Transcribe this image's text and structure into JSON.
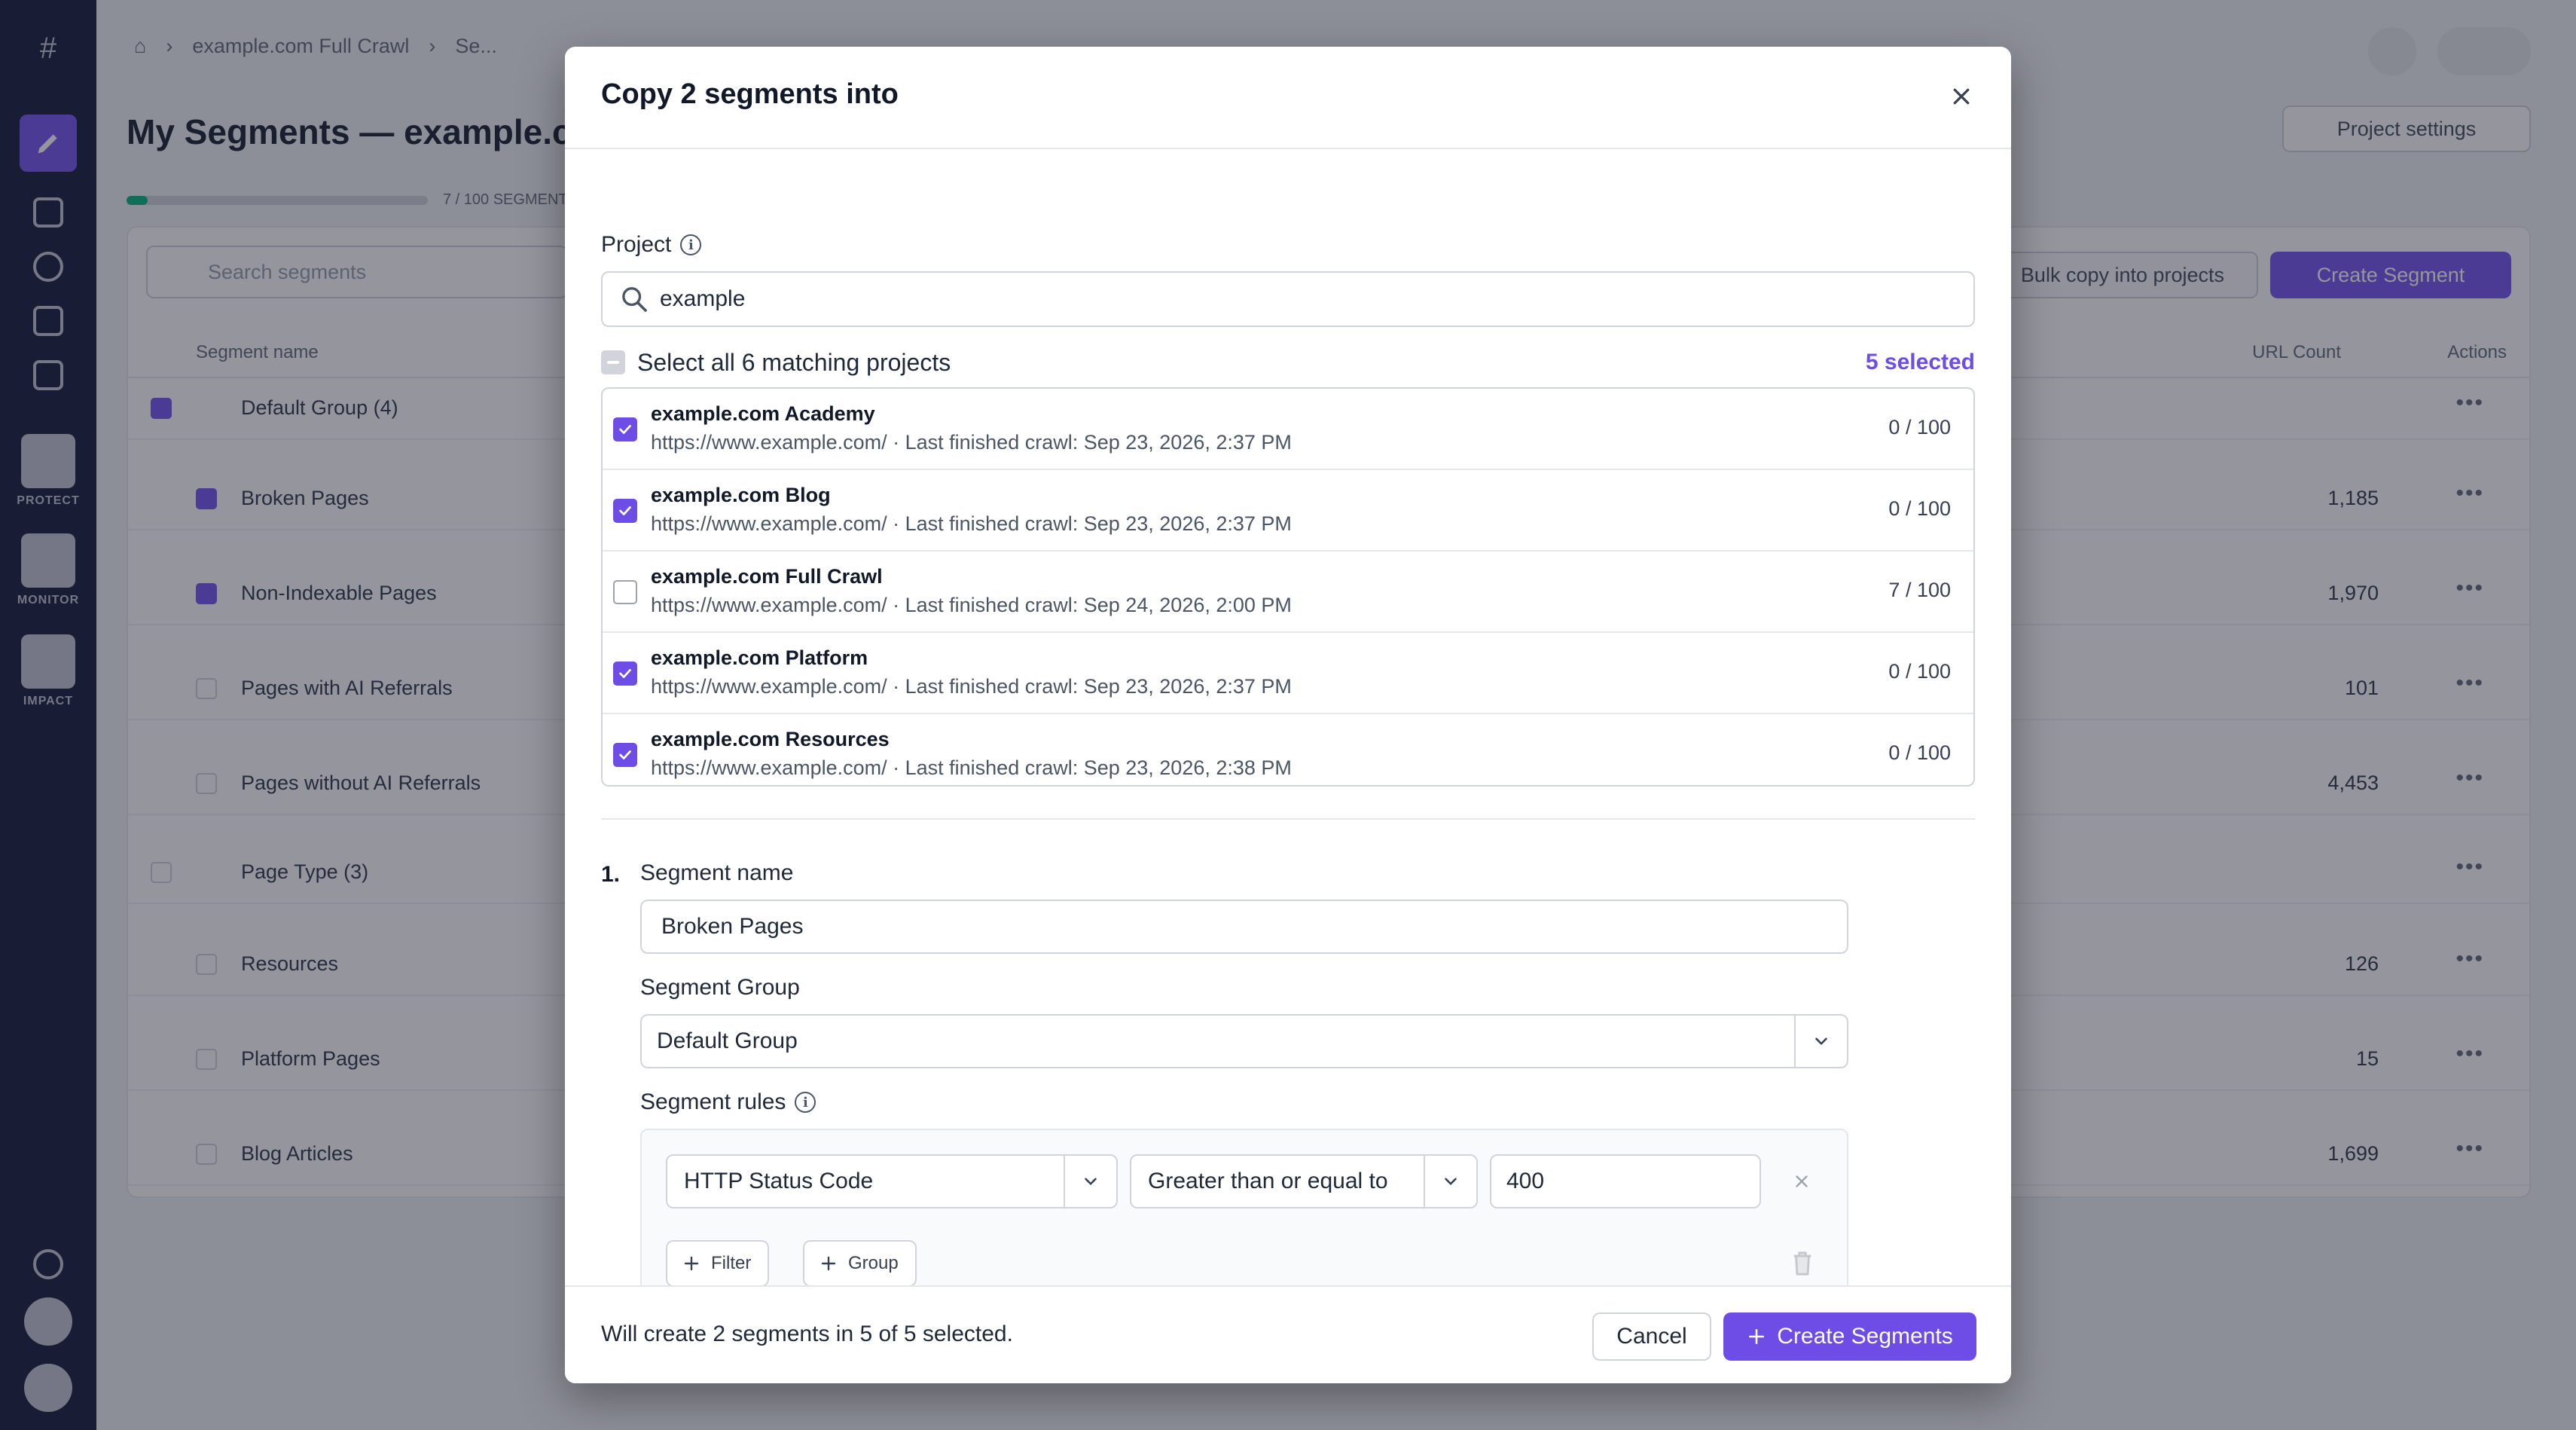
{
  "background": {
    "breadcrumb": [
      "example.com Full Crawl",
      "Se..."
    ],
    "page_title": "My Segments — example.c",
    "project_settings_label": "Project settings",
    "segments_progress": {
      "value": 7,
      "max": 100
    },
    "progress_label": "7 / 100 SEGMENTS",
    "search_placeholder": "Search segments",
    "bulk_copy_label": "Bulk copy into projects",
    "create_segment_label": "Create Segment",
    "columns": {
      "name": "Segment name",
      "count": "URL Count",
      "actions": "Actions"
    },
    "rows": [
      {
        "label": "Default Group (4)",
        "count": "",
        "group": true,
        "checked": true
      },
      {
        "label": "Broken Pages",
        "count": "1,185",
        "group": false,
        "checked": true
      },
      {
        "label": "Non-Indexable Pages",
        "count": "1,970",
        "group": false,
        "checked": true
      },
      {
        "label": "Pages with AI Referrals",
        "count": "101",
        "group": false,
        "checked": false
      },
      {
        "label": "Pages without AI Referrals",
        "count": "4,453",
        "group": false,
        "checked": false
      },
      {
        "label": "Page Type (3)",
        "count": "",
        "group": true,
        "checked": false
      },
      {
        "label": "Resources",
        "count": "126",
        "group": false,
        "checked": false
      },
      {
        "label": "Platform Pages",
        "count": "15",
        "group": false,
        "checked": false
      },
      {
        "label": "Blog Articles",
        "count": "1,699",
        "group": false,
        "checked": false
      }
    ],
    "sidebar_captions": [
      "PROTECT",
      "MONITOR",
      "IMPACT"
    ]
  },
  "modal": {
    "title": "Copy 2 segments into",
    "project_label": "Project",
    "project_search_value": "example",
    "select_all_label": "Select all 6 matching projects",
    "selected_count": "5 selected",
    "projects": [
      {
        "name": "example.com Academy",
        "detail": "https://www.example.com/ · Last finished crawl: Sep 23, 2026, 2:37 PM",
        "quota": "0 / 100",
        "checked": true
      },
      {
        "name": "example.com Blog",
        "detail": "https://www.example.com/ · Last finished crawl: Sep 23, 2026, 2:37 PM",
        "quota": "0 / 100",
        "checked": true
      },
      {
        "name": "example.com Full Crawl",
        "detail": "https://www.example.com/ · Last finished crawl: Sep 24, 2026, 2:00 PM",
        "quota": "7 / 100",
        "checked": false
      },
      {
        "name": "example.com Platform",
        "detail": "https://www.example.com/ · Last finished crawl: Sep 23, 2026, 2:37 PM",
        "quota": "0 / 100",
        "checked": true
      },
      {
        "name": "example.com Resources",
        "detail": "https://www.example.com/ · Last finished crawl: Sep 23, 2026, 2:38 PM",
        "quota": "0 / 100",
        "checked": true
      }
    ],
    "segment": {
      "index": "1.",
      "name_label": "Segment name",
      "name_value": "Broken Pages",
      "group_label": "Segment Group",
      "group_value": "Default Group",
      "rules_label": "Segment rules",
      "rule": {
        "field": "HTTP Status Code",
        "operator": "Greater than or equal to",
        "value": "400"
      },
      "filter_label": "Filter",
      "group_button_label": "Group"
    },
    "footer_text": "Will create 2 segments in 5 of 5 selected.",
    "cancel_label": "Cancel",
    "create_label": "Create Segments"
  },
  "colors": {
    "accent": "#6d4de6",
    "sidebar": "#1e2340"
  }
}
